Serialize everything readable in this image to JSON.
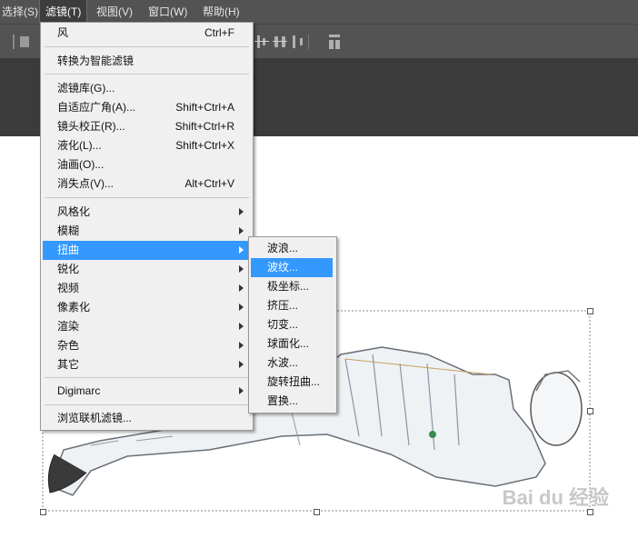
{
  "menubar": {
    "items": [
      {
        "label": "选择(S)"
      },
      {
        "label": "滤镜(T)"
      },
      {
        "label": "视图(V)"
      },
      {
        "label": "窗口(W)"
      },
      {
        "label": "帮助(H)"
      }
    ]
  },
  "filter_menu": {
    "items": [
      {
        "label": "风",
        "shortcut": "Ctrl+F"
      },
      {
        "label": "转换为智能滤镜",
        "shortcut": ""
      },
      {
        "label": "滤镜库(G)...",
        "shortcut": ""
      },
      {
        "label": "自适应广角(A)...",
        "shortcut": "Shift+Ctrl+A"
      },
      {
        "label": "镜头校正(R)...",
        "shortcut": "Shift+Ctrl+R"
      },
      {
        "label": "液化(L)...",
        "shortcut": "Shift+Ctrl+X"
      },
      {
        "label": "油画(O)...",
        "shortcut": ""
      },
      {
        "label": "消失点(V)...",
        "shortcut": "Alt+Ctrl+V"
      },
      {
        "label": "风格化",
        "shortcut": ""
      },
      {
        "label": "模糊",
        "shortcut": ""
      },
      {
        "label": "扭曲",
        "shortcut": ""
      },
      {
        "label": "锐化",
        "shortcut": ""
      },
      {
        "label": "视频",
        "shortcut": ""
      },
      {
        "label": "像素化",
        "shortcut": ""
      },
      {
        "label": "渲染",
        "shortcut": ""
      },
      {
        "label": "杂色",
        "shortcut": ""
      },
      {
        "label": "其它",
        "shortcut": ""
      },
      {
        "label": "Digimarc",
        "shortcut": ""
      },
      {
        "label": "浏览联机滤镜...",
        "shortcut": ""
      }
    ]
  },
  "distort_submenu": {
    "items": [
      {
        "label": "波浪..."
      },
      {
        "label": "波纹..."
      },
      {
        "label": "极坐标..."
      },
      {
        "label": "挤压..."
      },
      {
        "label": "切变..."
      },
      {
        "label": "球面化..."
      },
      {
        "label": "水波..."
      },
      {
        "label": "旋转扭曲..."
      },
      {
        "label": "置换..."
      }
    ]
  },
  "watermark": {
    "text": "Bai du 经验"
  },
  "colors": {
    "highlight": "#3399ff",
    "menu_bg": "#f0f0f0",
    "app_bg": "#535353"
  }
}
